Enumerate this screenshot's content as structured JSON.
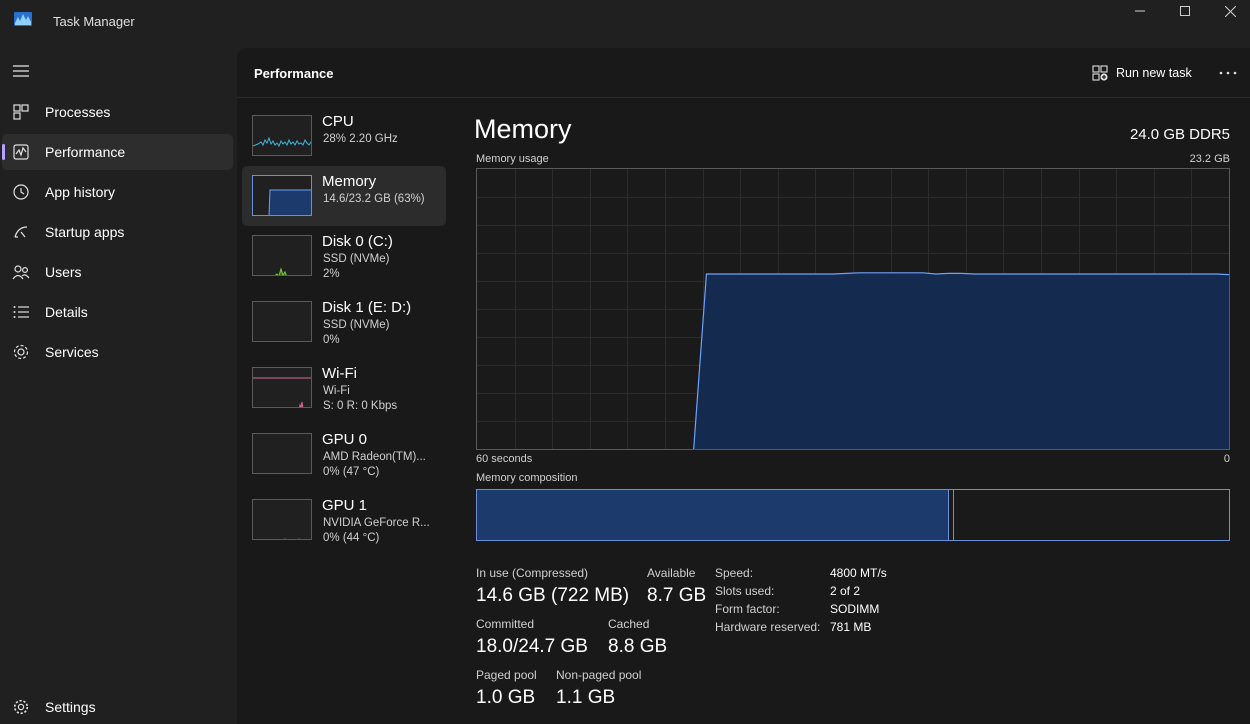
{
  "window": {
    "title": "Task Manager",
    "accent_color": "#b4a0ff",
    "graph_line_color": "#6fa0ff"
  },
  "nav": {
    "items": [
      {
        "label": "Processes",
        "icon": "processes-icon"
      },
      {
        "label": "Performance",
        "icon": "performance-icon",
        "active": true
      },
      {
        "label": "App history",
        "icon": "app-history-icon"
      },
      {
        "label": "Startup apps",
        "icon": "startup-apps-icon"
      },
      {
        "label": "Users",
        "icon": "users-icon"
      },
      {
        "label": "Details",
        "icon": "details-icon"
      },
      {
        "label": "Services",
        "icon": "services-icon"
      }
    ],
    "settings_label": "Settings"
  },
  "header": {
    "title": "Performance",
    "run_new_task": "Run new task"
  },
  "devices": [
    {
      "name": "CPU",
      "line1": "28%  2.20 GHz",
      "line2": ""
    },
    {
      "name": "Memory",
      "line1": "14.6/23.2 GB (63%)",
      "line2": ""
    },
    {
      "name": "Disk 0 (C:)",
      "line1": "SSD (NVMe)",
      "line2": "2%"
    },
    {
      "name": "Disk 1 (E: D:)",
      "line1": "SSD (NVMe)",
      "line2": "0%"
    },
    {
      "name": "Wi-Fi",
      "line1": "Wi-Fi",
      "line2": "S: 0  R: 0 Kbps"
    },
    {
      "name": "GPU 0",
      "line1": "AMD Radeon(TM)...",
      "line2": "0%  (47 °C)"
    },
    {
      "name": "GPU 1",
      "line1": "NVIDIA GeForce R...",
      "line2": "0%  (44 °C)"
    }
  ],
  "detail": {
    "title": "Memory",
    "memory_type": "24.0 GB DDR5",
    "usage_label": "Memory usage",
    "usage_max": "23.2 GB",
    "time_span": "60 seconds",
    "time_end": "0",
    "composition_label": "Memory composition",
    "stats": {
      "in_use_label": "In use (Compressed)",
      "in_use_value": "14.6 GB (722 MB)",
      "available_label": "Available",
      "available_value": "8.7 GB",
      "committed_label": "Committed",
      "committed_value": "18.0/24.7 GB",
      "cached_label": "Cached",
      "cached_value": "8.8 GB",
      "paged_label": "Paged pool",
      "paged_value": "1.0 GB",
      "nonpaged_label": "Non-paged pool",
      "nonpaged_value": "1.1 GB"
    },
    "specs": [
      {
        "key": "Speed:",
        "value": "4800 MT/s"
      },
      {
        "key": "Slots used:",
        "value": "2 of 2"
      },
      {
        "key": "Form factor:",
        "value": "SODIMM"
      },
      {
        "key": "Hardware reserved:",
        "value": "781 MB"
      }
    ],
    "usage_history_gb": [
      0,
      0,
      0,
      0,
      0,
      0,
      0,
      0,
      0,
      0,
      0,
      0,
      0,
      0,
      0,
      0,
      0,
      0,
      14.5,
      14.5,
      14.5,
      14.5,
      14.5,
      14.5,
      14.5,
      14.5,
      14.5,
      14.5,
      14.5,
      14.55,
      14.6,
      14.6,
      14.6,
      14.6,
      14.6,
      14.6,
      14.5,
      14.55,
      14.55,
      14.5,
      14.5,
      14.5,
      14.5,
      14.5,
      14.5,
      14.5,
      14.5,
      14.5,
      14.5,
      14.5,
      14.5,
      14.5,
      14.5,
      14.5,
      14.5,
      14.5,
      14.5,
      14.5,
      14.5,
      14.45
    ],
    "composition_fractions": {
      "in_use": 0.627,
      "modified": 0.006,
      "standby": 0.367
    }
  }
}
